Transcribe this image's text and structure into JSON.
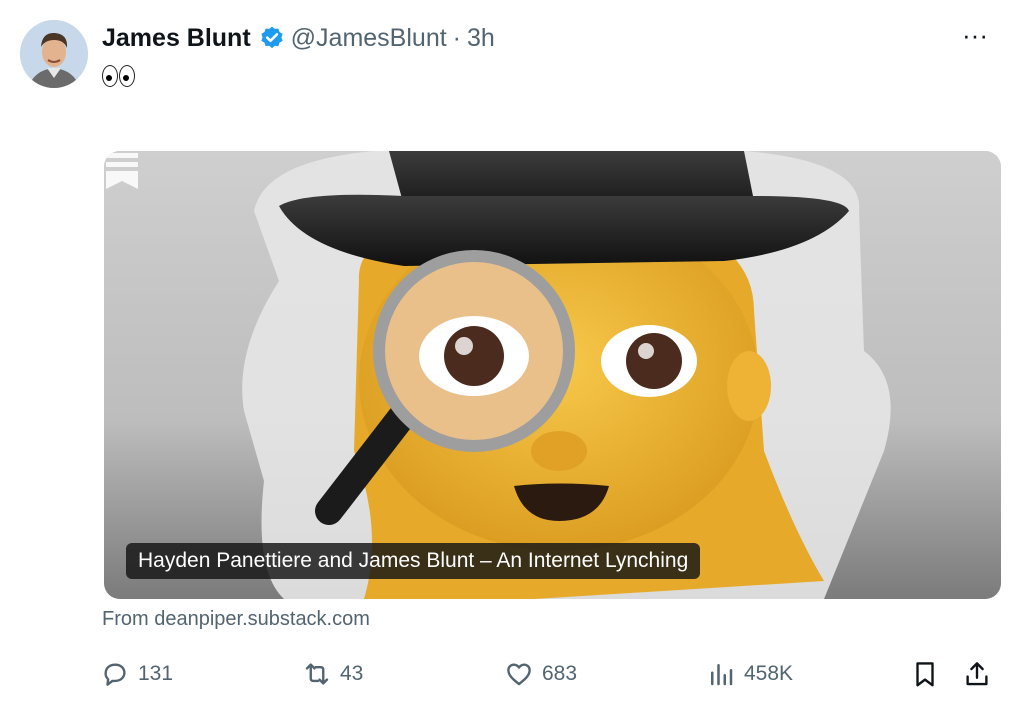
{
  "tweet": {
    "author_name": "James Blunt",
    "handle": "@JamesBlunt",
    "separator": "·",
    "time": "3h",
    "more_label": "···",
    "text_icon": "eyes-emoji"
  },
  "card": {
    "title": "Hayden Panettiere and James Blunt – An Internet Lynching",
    "image_icon": "detective-emoji",
    "source": "From deanpiper.substack.com"
  },
  "metrics": {
    "replies": "131",
    "reposts": "43",
    "likes": "683",
    "views": "458K"
  },
  "colors": {
    "verified": "#1d9bf0",
    "muted_text": "#536471",
    "primary_text": "#0f1419"
  }
}
